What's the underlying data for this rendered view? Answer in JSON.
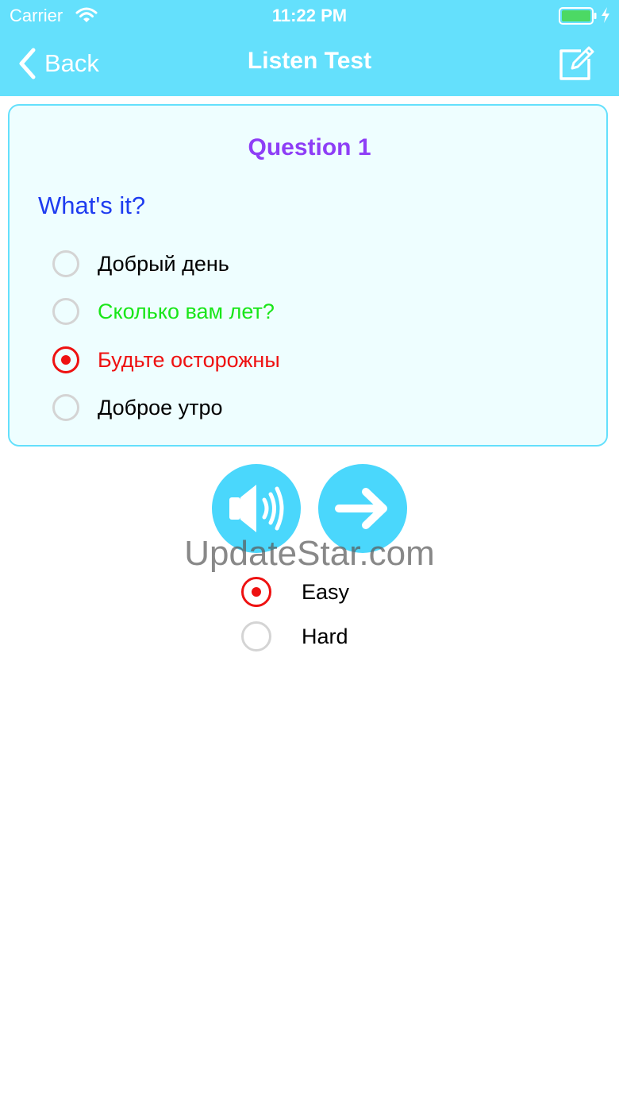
{
  "status_bar": {
    "carrier": "Carrier",
    "time": "11:22 PM"
  },
  "nav": {
    "back_label": "Back",
    "title": "Listen Test",
    "edit_icon": "edit-icon"
  },
  "question": {
    "title": "Question 1",
    "prompt": "What's it?",
    "options": [
      {
        "label": "Добрый день",
        "color": "#000000",
        "selected": false
      },
      {
        "label": "Сколько вам лет?",
        "color": "#19e619",
        "selected": false
      },
      {
        "label": "Будьте осторожны",
        "color": "#ee1111",
        "selected": true
      },
      {
        "label": "Доброе утро",
        "color": "#000000",
        "selected": false
      }
    ]
  },
  "controls": {
    "play_icon": "speaker-icon",
    "next_icon": "arrow-right-icon"
  },
  "watermark": "UpdateStar.com",
  "difficulty": [
    {
      "label": "Easy",
      "selected": true
    },
    {
      "label": "Hard",
      "selected": false
    }
  ],
  "colors": {
    "accent": "#64e0fc",
    "button": "#4ad7fc",
    "title": "#8e3ef6",
    "prompt": "#1e3cf0",
    "selected": "#ee1111"
  }
}
